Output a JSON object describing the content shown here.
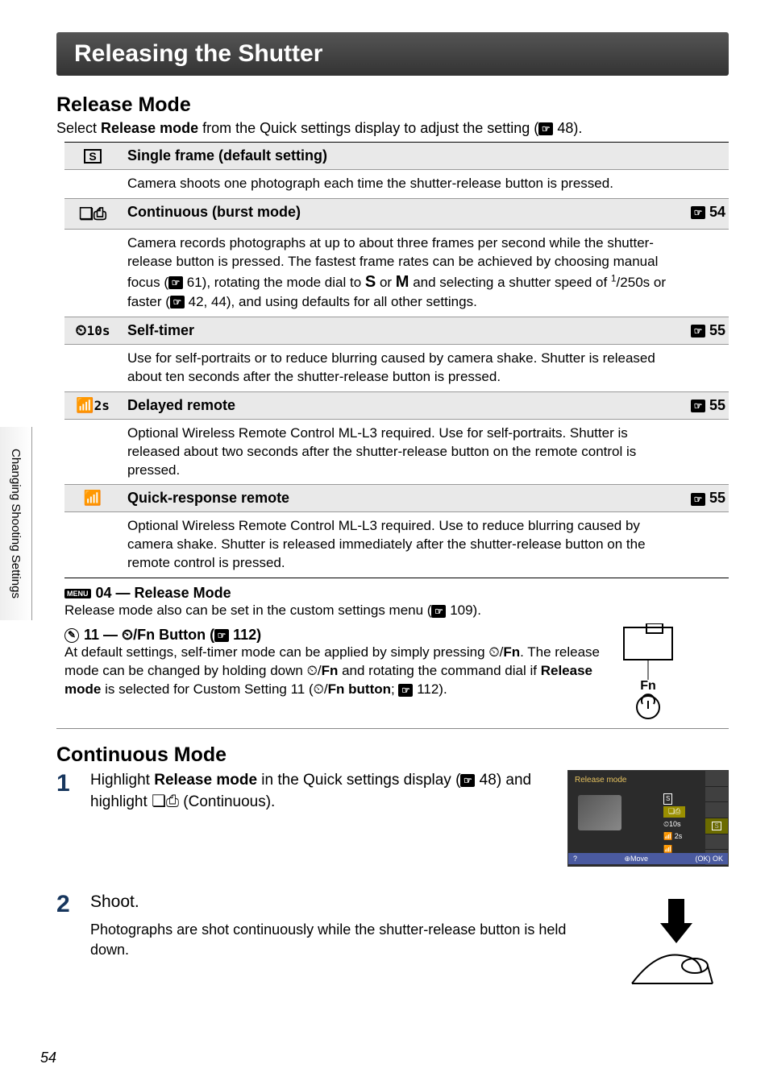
{
  "side_tab": "Changing Shooting Settings",
  "header": "Releasing the Shutter",
  "section1": {
    "title": "Release Mode",
    "intro_pre": "Select ",
    "intro_bold": "Release mode",
    "intro_post": " from the Quick settings display to adjust the setting (",
    "intro_ref": "48).",
    "rows": [
      {
        "icon_type": "s-frame",
        "label": "Single frame (default setting)",
        "desc": "Camera shoots one photograph each time the shutter-release button is pressed.",
        "ref": ""
      },
      {
        "icon_type": "burst",
        "label": "Continuous (burst mode)",
        "desc_pre": "Camera records photographs at up to about three frames per second while the shutter-release button is pressed. The fastest frame rates can be achieved by choosing manual focus (",
        "desc_mid1": " 61), rotating the mode dial to ",
        "desc_s": "S",
        "desc_or": " or ",
        "desc_m": "M",
        "desc_mid2": " and selecting a shutter speed of ",
        "desc_frac_num": "1",
        "desc_frac_den": "250",
        "desc_mid3": "s or faster (",
        "desc_post": " 42, 44), and using defaults for all other settings.",
        "ref": "54"
      },
      {
        "icon_type": "timer10s",
        "icon_text": "10s",
        "label": "Self-timer",
        "desc": "Use for self-portraits or to reduce blurring caused by camera shake. Shutter is released about ten seconds after the shutter-release button is pressed.",
        "ref": "55"
      },
      {
        "icon_type": "remote2s",
        "icon_text": "2s",
        "label": "Delayed remote",
        "desc": "Optional Wireless Remote Control ML-L3 required. Use for self-portraits. Shutter is released about two seconds after the shutter-release button on the remote control is pressed.",
        "ref": "55"
      },
      {
        "icon_type": "remote",
        "label": "Quick-response remote",
        "desc": "Optional Wireless Remote Control ML-L3 required. Use to reduce blurring caused by camera shake. Shutter is released immediately after the shutter-release button on the remote control is pressed.",
        "ref": "55"
      }
    ]
  },
  "note1": {
    "badge": "MENU",
    "head": "04 — Release Mode",
    "body_pre": "Release mode also can be set in the custom settings menu (",
    "body_post": " 109)."
  },
  "note2": {
    "head_pre": "11 — ",
    "head_fn": "Fn",
    "head_post": " Button (",
    "head_ref": " 112)",
    "body_p1_pre": "At default settings, self-timer mode can be applied by simply pressing ",
    "body_p1_fn": "Fn",
    "body_p1_post": ". The release mode can be changed by holding down ",
    "body_p2_fn": "Fn",
    "body_p2_mid": " and rotating the command dial if ",
    "body_p2_bold": "Release mode",
    "body_p2_mid2": " is selected for Custom Setting 11 (",
    "body_p3_fn": "Fn",
    "body_p3_bold": " button",
    "body_p3_post": "; ",
    "body_p3_ref": " 112)."
  },
  "fn_label": "Fn",
  "section2": {
    "title": "Continuous Mode",
    "step1_num": "1",
    "step1_pre": "Highlight ",
    "step1_bold": "Release mode",
    "step1_mid": " in the Quick settings display (",
    "step1_ref": " 48) and highlight ",
    "step1_post": " (Continuous).",
    "qs_title": "Release mode",
    "qs_opt1": "S",
    "qs_opt2": "10s",
    "qs_opt3": "2s",
    "qs_move": "Move",
    "qs_ok": "OK",
    "qs_side_s": "S",
    "step2_num": "2",
    "step2_label": "Shoot.",
    "step2_desc": "Photographs are shot continuously while the shutter-release button is held down."
  },
  "page_num": "54"
}
